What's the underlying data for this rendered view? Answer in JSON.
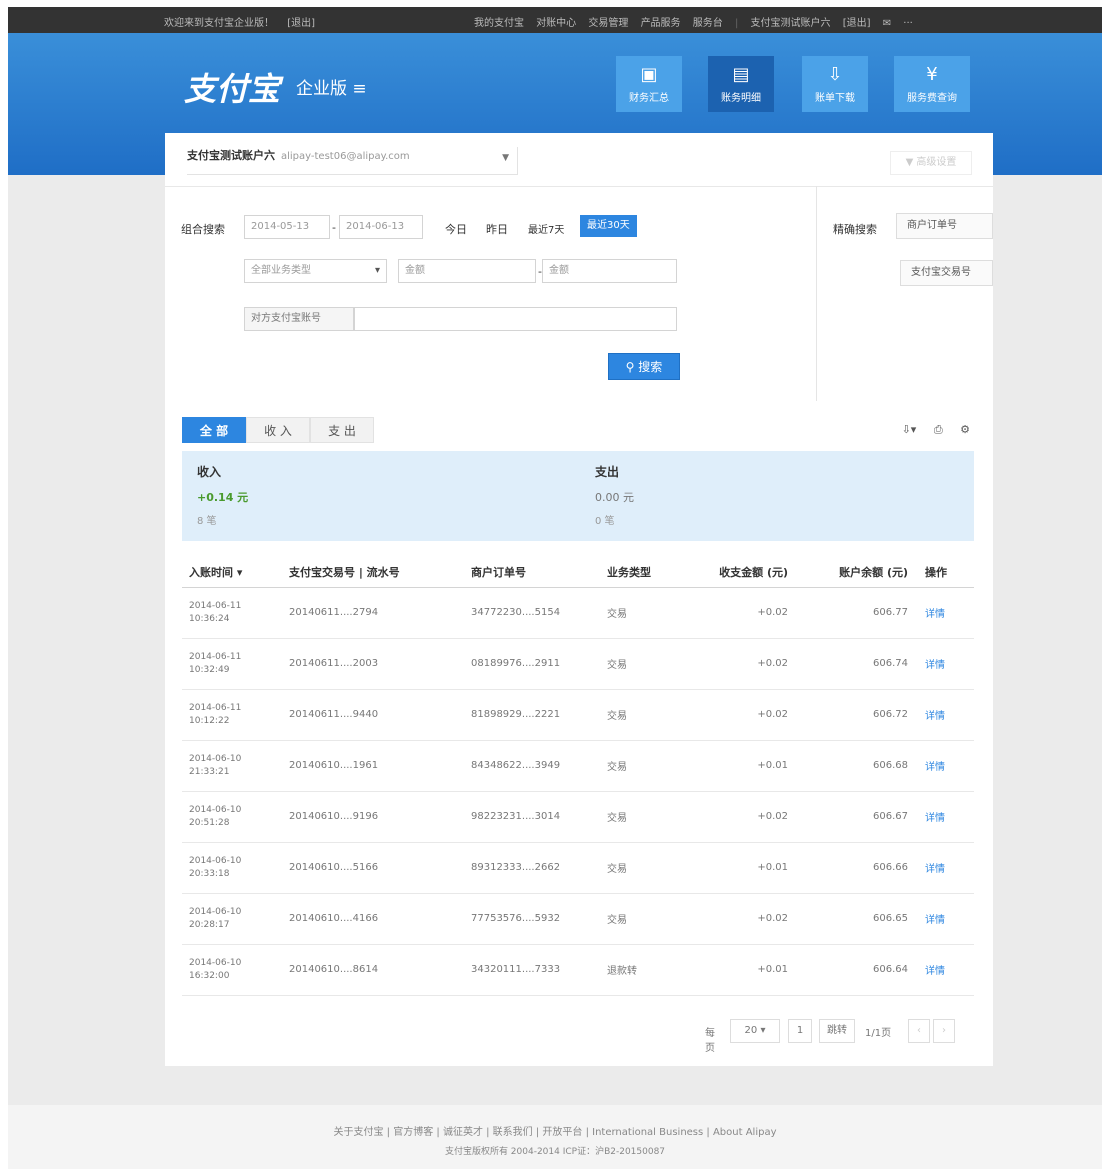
{
  "topbar": {
    "welcome": "欢迎来到支付宝企业版！",
    "logout": "[退出]",
    "links": [
      "我的支付宝",
      "对账中心",
      "交易管理",
      "产品服务",
      "服务台"
    ],
    "account": "支付宝测试账户六",
    "exit": "[退出]",
    "mail": "✉",
    "more": "···"
  },
  "header": {
    "logo": "支付宝",
    "edition": "企业版"
  },
  "nav": [
    {
      "label": "财务汇总",
      "icon": "monitor-icon"
    },
    {
      "label": "账务明细",
      "icon": "document-icon"
    },
    {
      "label": "账单下载",
      "icon": "download-icon"
    },
    {
      "label": "服务费查询",
      "icon": "yen-icon"
    }
  ],
  "account_select": {
    "name": "支付宝测试账户六",
    "email": "alipay-test06@alipay.com"
  },
  "settings_button": "▼ 高级设置",
  "search": {
    "label": "组合搜索",
    "date_start": "2014-05-13",
    "date_end": "2014-06-13",
    "date_sep": "-",
    "quick": [
      "今日",
      "昨日",
      "最近7天",
      "最近30天"
    ],
    "type_select": "全部业务类型",
    "amount_min_placeholder": "金额",
    "amount_sep": "-",
    "amount_max_placeholder": "金额",
    "opponent_label": "对方支付宝账号",
    "button": "搜索",
    "exact_label": "精确搜索",
    "exact_options": [
      "商户订单号",
      "支付宝交易号"
    ]
  },
  "tabs": [
    "全 部",
    "收 入",
    "支 出"
  ],
  "tools": {
    "download": "⇩▾",
    "print": "⎙",
    "settings": "⚙"
  },
  "summary": {
    "income": {
      "title": "收入",
      "amount": "+0.14 元",
      "count": "8 笔"
    },
    "expense": {
      "title": "支出",
      "amount": "0.00 元",
      "count": "0 笔"
    }
  },
  "table": {
    "headers": [
      "入账时间 ▾",
      "支付宝交易号 | 流水号",
      "商户订单号",
      "业务类型",
      "收支金额 (元)",
      "账户余额 (元)",
      "操作"
    ],
    "rows": [
      [
        "2014-06-11",
        "10:36:24",
        "20140611....2794",
        "34772230....5154",
        "交易",
        "+0.02",
        "606.77",
        "详情"
      ],
      [
        "2014-06-11",
        "10:32:49",
        "20140611....2003",
        "08189976....2911",
        "交易",
        "+0.02",
        "606.74",
        "详情"
      ],
      [
        "2014-06-11",
        "10:12:22",
        "20140611....9440",
        "81898929....2221",
        "交易",
        "+0.02",
        "606.72",
        "详情"
      ],
      [
        "2014-06-10",
        "21:33:21",
        "20140610....1961",
        "84348622....3949",
        "交易",
        "+0.01",
        "606.68",
        "详情"
      ],
      [
        "2014-06-10",
        "20:51:28",
        "20140610....9196",
        "98223231....3014",
        "交易",
        "+0.02",
        "606.67",
        "详情"
      ],
      [
        "2014-06-10",
        "20:33:18",
        "20140610....5166",
        "89312333....2662",
        "交易",
        "+0.01",
        "606.66",
        "详情"
      ],
      [
        "2014-06-10",
        "20:28:17",
        "20140610....4166",
        "77753576....5932",
        "交易",
        "+0.02",
        "606.65",
        "详情"
      ],
      [
        "2014-06-10",
        "16:32:00",
        "20140610....8614",
        "34320111....7333",
        "退款转",
        "+0.01",
        "606.64",
        "详情"
      ]
    ]
  },
  "pager": {
    "per_page_label": "每页",
    "per_page": "20",
    "page": "1",
    "go": "跳转",
    "total": "1/1页",
    "prev": "‹",
    "next": "›"
  },
  "footer": {
    "links": "关于支付宝 | 官方博客 | 诚征英才 | 联系我们 | 开放平台 | International Business | About Alipay",
    "copyright": "支付宝版权所有 2004-2014 ICP证：沪B2-20150087"
  }
}
